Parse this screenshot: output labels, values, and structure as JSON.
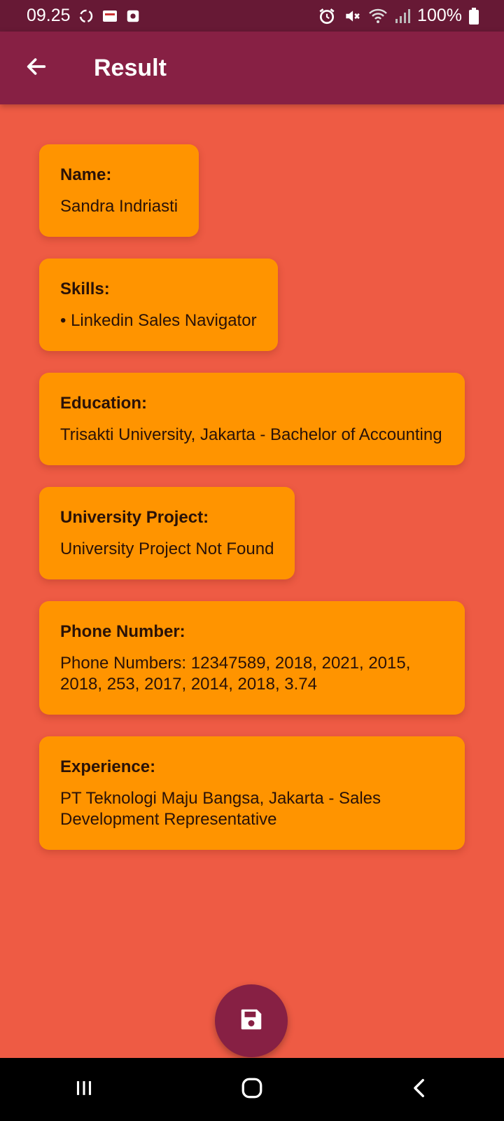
{
  "status_bar": {
    "time": "09.25",
    "battery": "100%",
    "left_icons": [
      "sync-icon",
      "news-icon",
      "recorder-icon"
    ],
    "right_icons": [
      "alarm-icon",
      "mute-icon",
      "wifi-icon",
      "signal-icon",
      "battery-icon"
    ]
  },
  "app_bar": {
    "title": "Result",
    "back_icon": "arrow-left-icon"
  },
  "cards": {
    "name": {
      "label": "Name:",
      "value": "Sandra Indriasti"
    },
    "skills": {
      "label": "Skills:",
      "value": "• Linkedin Sales Navigator"
    },
    "education": {
      "label": "Education:",
      "value": "Trisakti University, Jakarta - Bachelor of Accounting"
    },
    "university_project": {
      "label": "University Project:",
      "value": "University Project Not Found"
    },
    "phone": {
      "label": "Phone Number:",
      "value": "Phone Numbers: 12347589, 2018, 2021, 2015, 2018, 253, 2017, 2014, 2018, 3.74"
    },
    "experience": {
      "label": "Experience:",
      "value": "PT Teknologi Maju Bangsa, Jakarta - Sales Development Representative"
    }
  },
  "fab": {
    "icon": "save-icon"
  },
  "nav_bar": {
    "icons": [
      "recents-icon",
      "home-icon",
      "back-icon"
    ]
  },
  "colors": {
    "background": "#EE5B44",
    "app_bar": "#872044",
    "status_bar": "#671935",
    "card": "#FF9400",
    "fab": "#872044"
  }
}
